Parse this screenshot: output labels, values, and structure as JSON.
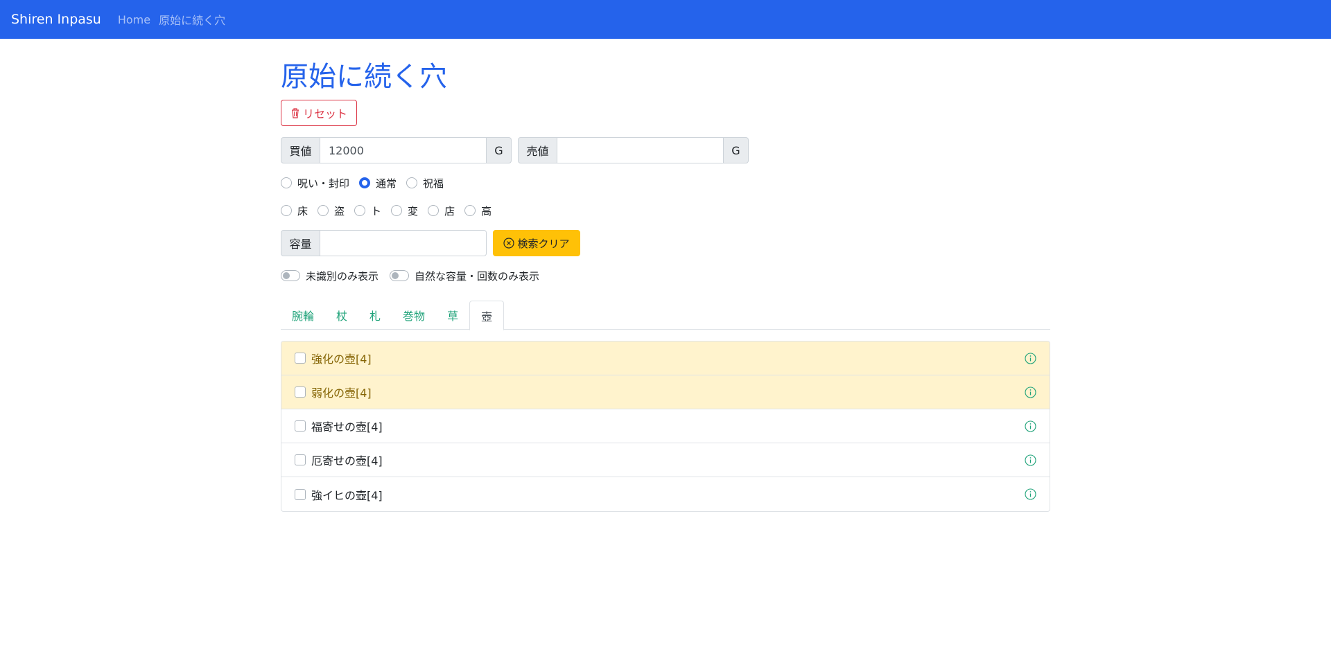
{
  "navbar": {
    "brand": "Shiren Inpasu",
    "links": [
      "Home",
      "原始に続く穴"
    ]
  },
  "page": {
    "title": "原始に続く穴",
    "reset_label": "リセット"
  },
  "price": {
    "buy_label": "買値",
    "buy_value": "12000",
    "buy_unit": "G",
    "sell_label": "売値",
    "sell_value": "",
    "sell_unit": "G"
  },
  "status_options": [
    {
      "label": "呪い・封印",
      "checked": false
    },
    {
      "label": "通常",
      "checked": true
    },
    {
      "label": "祝福",
      "checked": false
    }
  ],
  "source_options": [
    {
      "label": "床",
      "checked": false
    },
    {
      "label": "盗",
      "checked": false
    },
    {
      "label": "ト",
      "checked": false
    },
    {
      "label": "変",
      "checked": false
    },
    {
      "label": "店",
      "checked": false
    },
    {
      "label": "高",
      "checked": false
    }
  ],
  "capacity": {
    "label": "容量",
    "value": "",
    "clear_label": "検索クリア"
  },
  "switches": [
    {
      "label": "未識別のみ表示",
      "on": false
    },
    {
      "label": "自然な容量・回数のみ表示",
      "on": false
    }
  ],
  "tabs": [
    {
      "label": "腕輪",
      "active": false
    },
    {
      "label": "杖",
      "active": false
    },
    {
      "label": "札",
      "active": false
    },
    {
      "label": "巻物",
      "active": false
    },
    {
      "label": "草",
      "active": false
    },
    {
      "label": "壺",
      "active": true
    }
  ],
  "items": [
    {
      "label": "強化の壺[4]",
      "highlight": true,
      "checked": false
    },
    {
      "label": "弱化の壺[4]",
      "highlight": true,
      "checked": false
    },
    {
      "label": "福寄せの壺[4]",
      "highlight": false,
      "checked": false
    },
    {
      "label": "厄寄せの壺[4]",
      "highlight": false,
      "checked": false
    },
    {
      "label": "強イヒの壺[4]",
      "highlight": false,
      "checked": false
    }
  ],
  "colors": {
    "primary": "#2563eb",
    "danger": "#dc3545",
    "warning": "#ffc107",
    "highlight_row": "#fff3cd",
    "tab_link": "#20a37a"
  }
}
